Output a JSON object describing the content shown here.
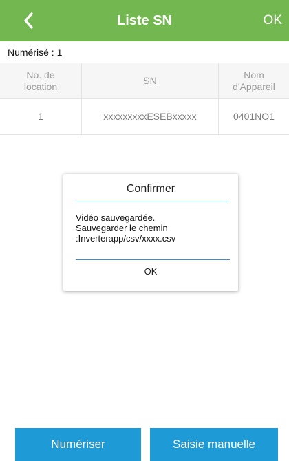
{
  "header": {
    "title": "Liste SN",
    "ok_label": "OK",
    "back_icon": "chevron-left-icon"
  },
  "scan_count_text": "Numérisé : 1",
  "table": {
    "columns": [
      {
        "line1": "No. de",
        "line2": "location"
      },
      {
        "line1": "SN",
        "line2": ""
      },
      {
        "line1": "Nom",
        "line2": "d'Appareil"
      }
    ],
    "rows": [
      {
        "location": "1",
        "sn": "xxxxxxxxxESEBxxxxx",
        "device": "0401NO1"
      }
    ]
  },
  "dialog": {
    "title": "Confirmer",
    "message_lines": [
      "Vidéo sauvegardée.",
      "Sauvegarder le chemin",
      ":Inverterapp/csv/xxxx.csv"
    ],
    "ok_label": "OK"
  },
  "buttons": {
    "scan_label": "Numériser",
    "manual_label": "Saisie manuelle"
  },
  "colors": {
    "header_bg": "#72b74f",
    "accent_line": "#2f93c6",
    "button_bg": "#1e9ad6"
  }
}
